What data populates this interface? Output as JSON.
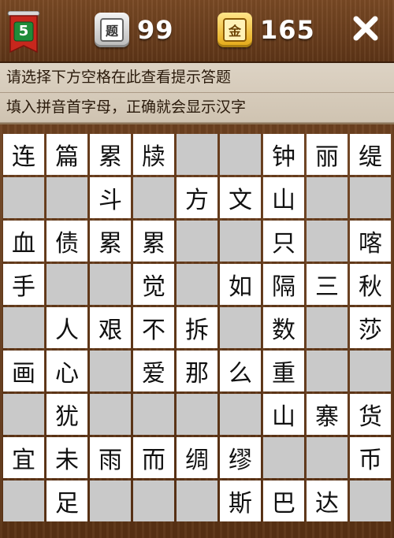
{
  "header": {
    "level": "5",
    "questions_icon_label": "题",
    "questions_count": "99",
    "gold_icon_label": "金",
    "gold_count": "165",
    "close_symbol": "✕"
  },
  "hints": {
    "line1": "请选择下方空格在此查看提示答题",
    "line2": "填入拼音首字母，正确就会显示汉字"
  },
  "colors": {
    "wood": "#6a3e1c",
    "filled_cell": "#ffffff",
    "empty_cell": "#c9c9c9",
    "hint_bg": "#ddd3c4",
    "badge_red": "#c7271d",
    "badge_green": "#1f8c3a"
  },
  "board": {
    "rows": [
      [
        "连",
        "篇",
        "累",
        "牍",
        "",
        "",
        "钟",
        "丽",
        "缇"
      ],
      [
        "",
        "",
        "斗",
        "",
        "方",
        "文",
        "山",
        "",
        ""
      ],
      [
        "血",
        "债",
        "累",
        "累",
        "",
        "",
        "只",
        "",
        "喀"
      ],
      [
        "手",
        "",
        "",
        "觉",
        "",
        "如",
        "隔",
        "三",
        "秋"
      ],
      [
        "",
        "人",
        "艰",
        "不",
        "拆",
        "",
        "数",
        "",
        "莎"
      ],
      [
        "画",
        "心",
        "",
        "爱",
        "那",
        "么",
        "重",
        "",
        ""
      ],
      [
        "",
        "犹",
        "",
        "",
        "",
        "",
        "山",
        "寨",
        "货"
      ],
      [
        "宜",
        "未",
        "雨",
        "而",
        "绸",
        "缪",
        "",
        "",
        "币"
      ],
      [
        "",
        "足",
        "",
        "",
        "",
        "斯",
        "巴",
        "达",
        ""
      ]
    ]
  }
}
